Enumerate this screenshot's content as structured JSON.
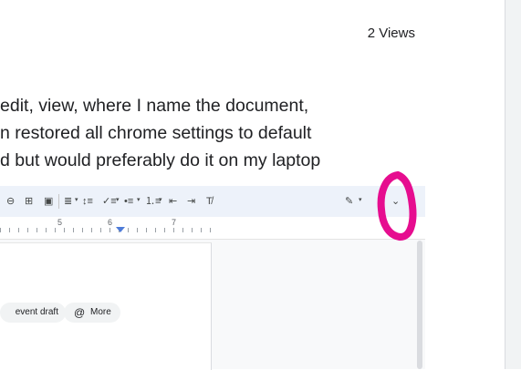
{
  "header": {
    "views": "2 Views"
  },
  "post": {
    "lines": [
      "edit, view, where I name the document,",
      "n restored all chrome settings to default",
      "d but would preferably do it on my laptop"
    ]
  },
  "toolbar": {
    "items": [
      {
        "name": "link-icon",
        "glyph": "⊖"
      },
      {
        "name": "add-comment-icon",
        "glyph": "⊞"
      },
      {
        "name": "insert-image-icon",
        "glyph": "▣"
      },
      {
        "name": "align-icon",
        "glyph": "≣"
      },
      {
        "name": "line-spacing-icon",
        "glyph": "↕≡"
      },
      {
        "name": "checklist-icon",
        "glyph": "✓≡"
      },
      {
        "name": "bulleted-list-icon",
        "glyph": "•≡"
      },
      {
        "name": "numbered-list-icon",
        "glyph": "⒈≡"
      },
      {
        "name": "decrease-indent-icon",
        "glyph": "⇤"
      },
      {
        "name": "increase-indent-icon",
        "glyph": "⇥"
      },
      {
        "name": "clear-formatting-icon",
        "glyph": "T̸"
      },
      {
        "name": "editing-mode-icon",
        "glyph": "✎"
      },
      {
        "name": "expand-toolbar-icon",
        "glyph": "⌄"
      }
    ]
  },
  "ruler": {
    "labels": [
      "5",
      "6",
      "7"
    ]
  },
  "chips": {
    "draft": "event draft",
    "more": "More",
    "more_icon": "@"
  },
  "colors": {
    "annotation": "#e60d8f",
    "accent": "#4f7cd8",
    "toolbar_bg": "#edf2fa"
  }
}
